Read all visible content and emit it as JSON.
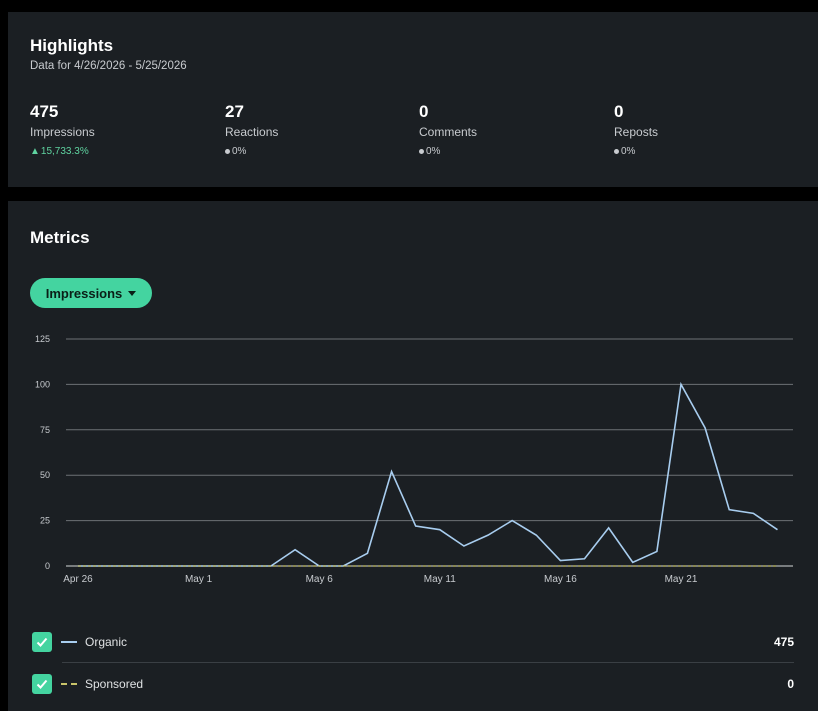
{
  "highlights": {
    "title": "Highlights",
    "subtitle": "Data for 4/26/2026 - 5/25/2026",
    "stats": [
      {
        "value": "475",
        "label": "Impressions",
        "change": "15,733.3%",
        "trend": "up"
      },
      {
        "value": "27",
        "label": "Reactions",
        "change": "0%",
        "trend": "flat"
      },
      {
        "value": "0",
        "label": "Comments",
        "change": "0%",
        "trend": "flat"
      },
      {
        "value": "0",
        "label": "Reposts",
        "change": "0%",
        "trend": "flat"
      }
    ]
  },
  "metrics": {
    "title": "Metrics",
    "dropdown_label": "Impressions"
  },
  "legend": {
    "organic_label": "Organic",
    "organic_total": "475",
    "sponsored_label": "Sponsored",
    "sponsored_total": "0"
  },
  "colors": {
    "accent": "#44d4a0",
    "organic_line": "#a8cdef",
    "sponsored_line": "#c9c46a",
    "background": "#1b1f23"
  },
  "chart_data": {
    "type": "line",
    "x": [
      "Apr 26",
      "Apr 27",
      "Apr 28",
      "Apr 29",
      "Apr 30",
      "May 1",
      "May 2",
      "May 3",
      "May 4",
      "May 5",
      "May 6",
      "May 7",
      "May 8",
      "May 9",
      "May 10",
      "May 11",
      "May 12",
      "May 13",
      "May 14",
      "May 15",
      "May 16",
      "May 17",
      "May 18",
      "May 19",
      "May 20",
      "May 21",
      "May 22",
      "May 23",
      "May 24",
      "May 25"
    ],
    "tick_labels": [
      "Apr 26",
      "May 1",
      "May 6",
      "May 11",
      "May 16",
      "May 21"
    ],
    "yticks": [
      0,
      25,
      50,
      75,
      100,
      125
    ],
    "ylim": [
      0,
      125
    ],
    "grid": true,
    "series": [
      {
        "name": "Organic",
        "style": "solid",
        "values": [
          0,
          0,
          0,
          0,
          0,
          0,
          0,
          0,
          0,
          9,
          0,
          0,
          7,
          52,
          22,
          20,
          11,
          17,
          25,
          17,
          3,
          4,
          21,
          2,
          8,
          100,
          76,
          31,
          29,
          20
        ]
      },
      {
        "name": "Sponsored",
        "style": "dashed",
        "values": [
          0,
          0,
          0,
          0,
          0,
          0,
          0,
          0,
          0,
          0,
          0,
          0,
          0,
          0,
          0,
          0,
          0,
          0,
          0,
          0,
          0,
          0,
          0,
          0,
          0,
          0,
          0,
          0,
          0,
          0
        ]
      }
    ]
  }
}
